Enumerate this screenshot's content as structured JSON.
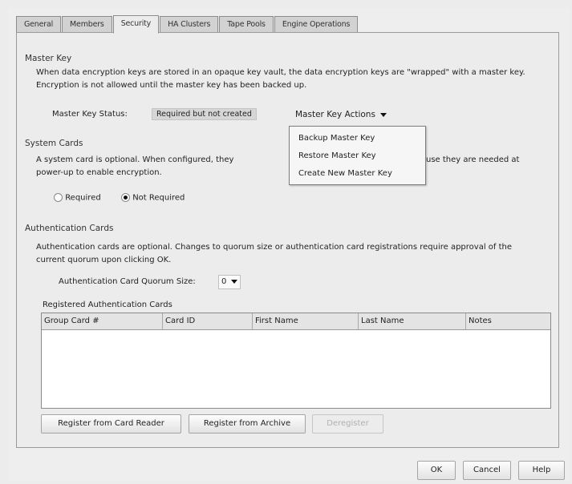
{
  "tabs": [
    {
      "label": "General",
      "active": false
    },
    {
      "label": "Members",
      "active": false
    },
    {
      "label": "Security",
      "active": true
    },
    {
      "label": "HA Clusters",
      "active": false
    },
    {
      "label": "Tape Pools",
      "active": false
    },
    {
      "label": "Engine Operations",
      "active": false
    }
  ],
  "master_key": {
    "title": "Master Key",
    "description": "When data encryption keys are stored in an opaque key vault, the data encryption keys are \"wrapped\" with a master key. Encryption is not allowed until the master key has been backed up.",
    "status_label": "Master Key Status:",
    "status_value": "Required but not created",
    "actions_label": "Master Key Actions",
    "actions_menu": [
      "Backup Master Key",
      "Restore Master Key",
      "Create New Master Key"
    ]
  },
  "system_cards": {
    "title": "System Cards",
    "description_line1_left": "A system card is optional. When configured, they ",
    "description_line1_right": "use they are needed at",
    "description_line2": "power-up to enable encryption.",
    "options": [
      {
        "label": "Required",
        "selected": false
      },
      {
        "label": "Not Required",
        "selected": true
      }
    ]
  },
  "auth_cards": {
    "title": "Authentication Cards",
    "description": "Authentication cards are optional. Changes to quorum size or authentication card registrations require approval of the current quorum upon clicking OK.",
    "quorum_label": "Authentication Card Quorum Size:",
    "quorum_value": "0",
    "registered_title": "Registered Authentication Cards",
    "columns": [
      "Group Card #",
      "Card ID",
      "First Name",
      "Last Name",
      "Notes"
    ],
    "rows": [],
    "buttons": {
      "register_reader": "Register from Card Reader",
      "register_archive": "Register from Archive",
      "deregister": "Deregister"
    }
  },
  "footer": {
    "ok": "OK",
    "cancel": "Cancel",
    "help": "Help"
  }
}
